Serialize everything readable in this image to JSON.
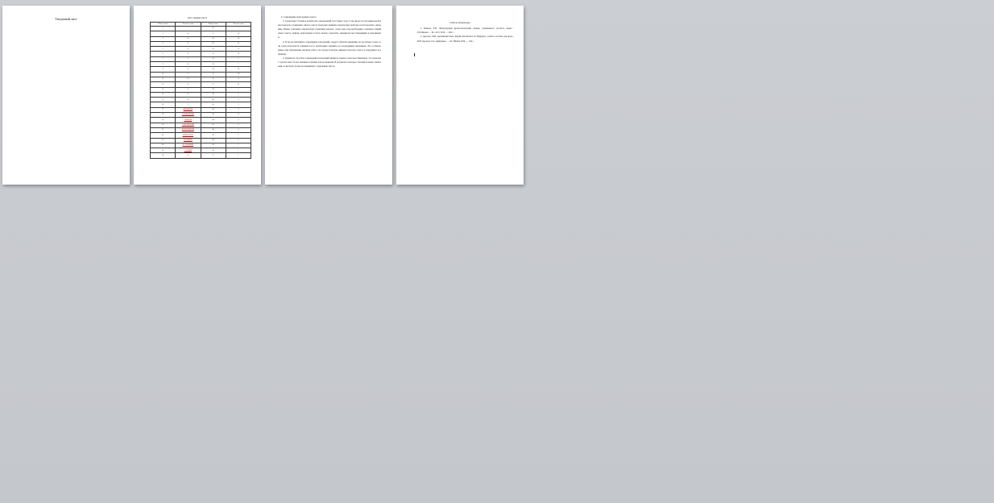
{
  "pages": {
    "title_page": {
      "text": "Титульный лист"
    },
    "table_page": {
      "caption": "лист оценки текста",
      "headers": [
        "Номер слова",
        "Частота слова",
        "Номер слова",
        "Частота слова"
      ],
      "rows": [
        [
          "1",
          "—",
          "26",
          "1"
        ],
        [
          "2",
          "18",
          "27",
          "16"
        ],
        [
          "3",
          "12",
          "28",
          "15"
        ],
        [
          "4",
          "8",
          "29",
          "13"
        ],
        [
          "5",
          "6",
          "30",
          "4"
        ],
        [
          "6",
          "9",
          "31",
          "12"
        ],
        [
          "7",
          "3",
          "32",
          "5"
        ],
        [
          "8",
          "10",
          "33",
          "7"
        ],
        [
          "9",
          "11",
          "34",
          "19"
        ],
        [
          "10",
          "2",
          "35",
          "18"
        ],
        [
          "11",
          "14",
          "36",
          "4"
        ],
        [
          "12",
          "6",
          "37",
          "20"
        ],
        [
          "13",
          "4",
          "38",
          "1"
        ],
        [
          "14",
          "9",
          "39",
          "3"
        ],
        [
          "15",
          "16",
          "40",
          "9"
        ],
        [
          "16",
          "3",
          "41",
          "2"
        ],
        [
          "17",
          "ВВЕДЕНИЕ",
          "42",
          "3"
        ],
        [
          "18",
          "ЗАКЛЮЧЕНИЕ",
          "43",
          "11"
        ],
        [
          "19",
          "СЛОВАРЬ",
          "44",
          "5"
        ],
        [
          "20",
          "СОКРАЩЕНИЯ",
          "45",
          "8"
        ],
        [
          "21",
          "ПРИЛОЖЕНИЕ",
          "46",
          "4"
        ],
        [
          "22",
          "ЛИТЕРАТУРА",
          "47",
          "7"
        ],
        [
          "23",
          "ТЕРМИНЫ",
          "48",
          "6"
        ],
        [
          "24",
          "ИСТОЧНИКИ",
          "49",
          "2"
        ],
        [
          "25",
          "ССЫЛКИ",
          "50",
          "1"
        ],
        [
          "26",
          "15",
          "51",
          "1"
        ]
      ]
    },
    "text_page": {
      "heading": "2. Сокращение повторения в тексте",
      "paragraphs": [
        "3. Существует большое количество определений частотных слов, в том числе и в изучении проблемы повторов. Сравнение смысла текста позволяет выявить лексические повторы и использовать синонимы. Важно учитывать лексическую семантику каждого слова, при этом необходимо сохранять общий смысл текста. Однако повторения в тексте можно сократить, заменяя их местоимениями и синонимами.",
        "4. Если рассматривать сокращение повторений, следует обратить внимание на частотные слова: если слово встречается слишком часто, необходимо заменить его подходящим синонимом. Это особенно важно при оформлении научных работ, где частые повторы снижают качество текста и затрудняют восприятие.",
        "5. Одним из способов сокращения повторений является замена слова местоимением, что позволяет сделать текст более связным и лёгким для восприятия. В результате повторы становятся менее заметными, и читатель лучше воспринимает содержание текста."
      ]
    },
    "refs_page": {
      "title": "Список литературы",
      "items": [
        "1. Иванов, Е.И. Литературный фразеологический словарь современного русского языка / Е.И.Иванов. — М.: АСТ, 2010. — 464 с.",
        "2. Дорохов, М.В. Английский язык. English Introduction for Beginners: учебное пособие для вузов / М.В. Дорохов, О.А. Дмитриева. — М.: Юрайт, 2020. — 194 с."
      ]
    }
  },
  "colors": {
    "background": "#c6c9ce",
    "page": "#ffffff",
    "markup_red": "#c00000"
  }
}
